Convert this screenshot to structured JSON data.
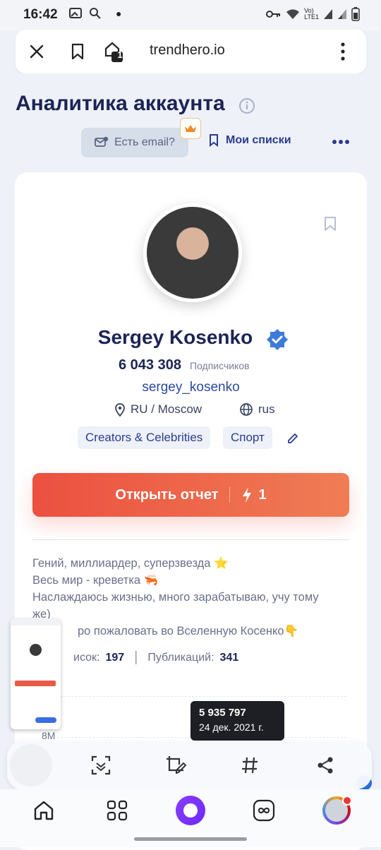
{
  "status_bar": {
    "time": "16:42"
  },
  "browser": {
    "url": "trendhero.io",
    "tabs_count": "1"
  },
  "page": {
    "title": "Аналитика аккаунта",
    "email_button": "Есть email?",
    "my_lists": "Мои списки"
  },
  "profile": {
    "name": "Sergey Kosenko",
    "followers": "6 043 308",
    "followers_label": "Подписчиков",
    "handle": "sergey_kosenko",
    "location": "RU / Moscow",
    "language": "rus",
    "tags": [
      "Creators & Celebrities",
      "Спорт"
    ],
    "open_report": "Открыть отчет",
    "report_credits": "1",
    "bio_lines": [
      "Гений, миллиардер, суперзвезда ⭐",
      "Весь мир - креветка 🦐",
      "Наслаждаюсь жизнью, много зарабатываю, учу тому",
      "же)",
      "ро пожаловать во Вселенную Косенко👇"
    ],
    "following_label": "исок:",
    "following": "197",
    "posts_label": "Публикаций:",
    "posts": "341"
  },
  "chart": {
    "y_label": "8M",
    "tooltip_value": "5 935 797",
    "tooltip_date": "24 дек. 2021 г."
  },
  "colors": {
    "accent_start": "#ec5040",
    "accent_end": "#ef7d55",
    "brand": "#2a3b8f",
    "verified": "#3c7bd9"
  }
}
